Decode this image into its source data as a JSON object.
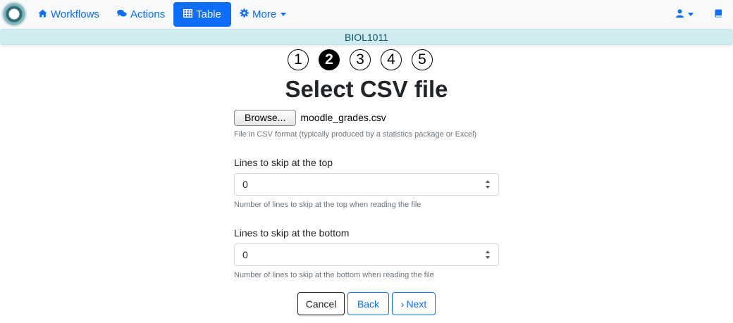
{
  "nav": {
    "workflows": {
      "icon": "home-icon",
      "label": "Workflows"
    },
    "actions": {
      "icon": "comments-icon",
      "label": "Actions"
    },
    "table": {
      "icon": "table-icon",
      "label": "Table"
    },
    "more": {
      "icon": "gear-icon",
      "label": "More"
    },
    "user_icon": "user-icon",
    "docs_icon": "book-icon",
    "accent": "#0d6efd"
  },
  "course": {
    "name": "BIOL1011"
  },
  "steps": [
    "1",
    "2",
    "3",
    "4",
    "5"
  ],
  "current_step": 2,
  "page_title": "Select CSV file",
  "file": {
    "browse_label": "Browse...",
    "file_name": "moodle_grades.csv",
    "help": "File in CSV format (typically produced by a statistics package or Excel)"
  },
  "skip_top": {
    "label": "Lines to skip at the top",
    "value": "0",
    "help": "Number of lines to skip at the top when reading the file"
  },
  "skip_bottom": {
    "label": "Lines to skip at the bottom",
    "value": "0",
    "help": "Number of lines to skip at the bottom when reading the file"
  },
  "buttons": {
    "cancel": "Cancel",
    "back": "Back",
    "next": "Next"
  }
}
